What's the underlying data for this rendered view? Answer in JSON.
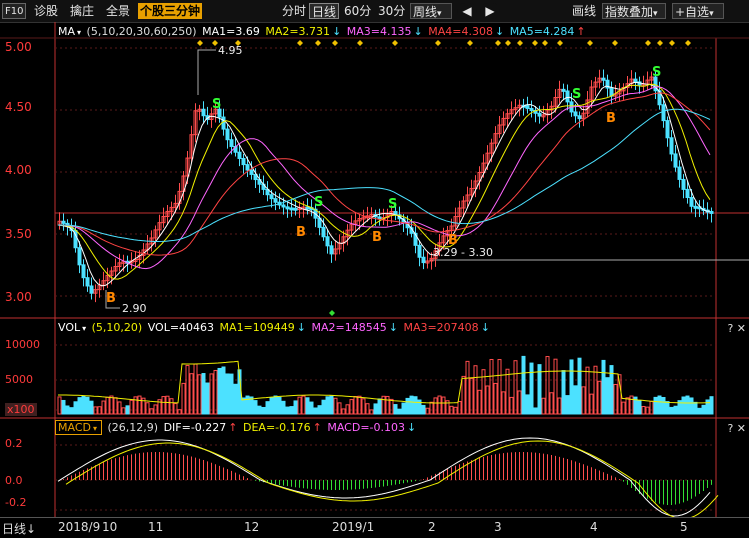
{
  "toolbar": {
    "f10": "F10",
    "diagnose": "诊股",
    "seat": "擒庄",
    "fullscreen": "全景",
    "active_tab": "个股三分钟",
    "tabs": [
      "分时",
      "日线",
      "60分",
      "30分"
    ],
    "period_dropdown": "周线",
    "prev": "◀",
    "next": "▶",
    "line_label": "画线",
    "overlay_dropdown": "指数叠加",
    "favorites": "+自选"
  },
  "ma_legend": {
    "name": "MA",
    "params": "(5,10,20,30,60,250)",
    "ma1": "MA1=3.69",
    "ma2": "MA2=3.731",
    "ma3": "MA3=4.135",
    "ma4": "MA4=4.308",
    "ma5": "MA5=4.284"
  },
  "vol_legend": {
    "name": "VOL",
    "params": "(5,10,20)",
    "vol": "VOL=40463",
    "ma1": "MA1=109449",
    "ma2": "MA2=148545",
    "ma3": "MA3=207408"
  },
  "macd_legend": {
    "name": "MACD",
    "params": "(26,12,9)",
    "dif": "DIF=-0.227",
    "dea": "DEA=-0.176",
    "macd": "MACD=-0.103"
  },
  "price_axis": [
    "5.00",
    "4.50",
    "4.00",
    "3.50",
    "3.00"
  ],
  "vol_axis": [
    "10000",
    "5000",
    "x100"
  ],
  "macd_axis": [
    "0.2",
    "0.0",
    "-0.2"
  ],
  "annotations": {
    "high": "4.95",
    "low": "2.90",
    "mid": "3.29 - 3.30"
  },
  "x_axis": {
    "mode": "日线",
    "labels": [
      "2018/9",
      "10",
      "11",
      "12",
      "2019/1",
      "2",
      "3",
      "4",
      "5"
    ]
  },
  "panel_tools": "? ✕",
  "colors": {
    "up": "#ff4d4d",
    "down": "#4ce1ff",
    "ma1": "#ffffff",
    "ma2": "#f0f000",
    "ma3": "#ff66ff",
    "ma4": "#ff4444",
    "ma5": "#4ce1ff",
    "axis": "#c03030"
  }
}
